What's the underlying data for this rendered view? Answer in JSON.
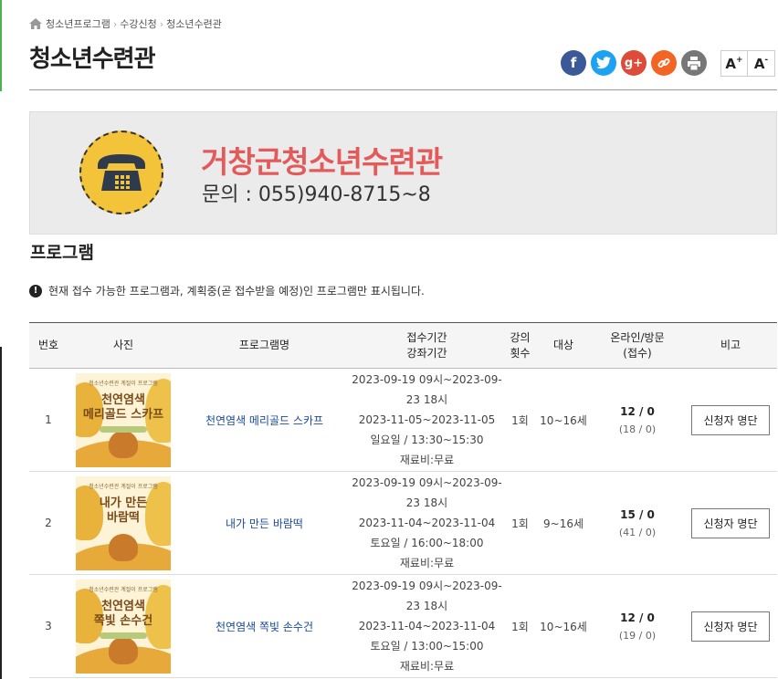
{
  "breadcrumb": [
    "청소년프로그램",
    "수강신청",
    "청소년수련관"
  ],
  "page_title": "청소년수련관",
  "share": {
    "facebook": "f",
    "twitter": "t",
    "google": "g+",
    "font_up": "A",
    "font_down": "A",
    "font_up_sign": "+",
    "font_down_sign": "-"
  },
  "contact": {
    "org": "거창군청소년수련관",
    "tel": "문의 : 055)940-8715~8"
  },
  "section_title": "프로그램",
  "notice": "현재 접수 가능한 프로그램과, 계획중(곧 접수받을 예정)인 프로그램만 표시됩니다.",
  "table": {
    "headers": {
      "no": "번호",
      "photo": "사진",
      "name": "프로그램명",
      "period1": "접수기간",
      "period2": "강좌기간",
      "count1": "강의",
      "count2": "횟수",
      "target": "대상",
      "online1": "온라인/방문",
      "online2": "(접수)",
      "note": "비고"
    },
    "rows": [
      {
        "no": "1",
        "thumb_small": "청소년수련관 계절이 프로그램",
        "thumb_title1": "천연염색",
        "thumb_title2": "메리골드 스카프",
        "name": "천연염색 메리골드 스카프",
        "reg": "2023-09-19 09시~2023-09-23 18시",
        "course": "2023-11-05~2023-11-05",
        "time": "일요일 / 13:30~15:30",
        "fee": "재료비:무료",
        "count": "1회",
        "target": "10~16세",
        "online": "12 / 0",
        "visit": "(18 / 0)",
        "button": "신청자 명단"
      },
      {
        "no": "2",
        "thumb_small": "청소년수련관 계절이 프로그램",
        "thumb_title1": "내가 만든",
        "thumb_title2": "바람떡",
        "name": "내가 만든 바람떡",
        "reg": "2023-09-19 09시~2023-09-23 18시",
        "course": "2023-11-04~2023-11-04",
        "time": "토요일 / 16:00~18:00",
        "fee": "재료비:무료",
        "count": "1회",
        "target": "9~16세",
        "online": "15 / 0",
        "visit": "(41 / 0)",
        "button": "신청자 명단"
      },
      {
        "no": "3",
        "thumb_small": "청소년수련관 계절이 프로그램",
        "thumb_title1": "천연염색",
        "thumb_title2": "쪽빛 손수건",
        "name": "천연염색 쪽빛 손수건",
        "reg": "2023-09-19 09시~2023-09-23 18시",
        "course": "2023-11-04~2023-11-04",
        "time": "토요일 / 13:00~15:00",
        "fee": "재료비:무료",
        "count": "1회",
        "target": "10~16세",
        "online": "12 / 0",
        "visit": "(19 / 0)",
        "button": "신청자 명단"
      }
    ]
  }
}
